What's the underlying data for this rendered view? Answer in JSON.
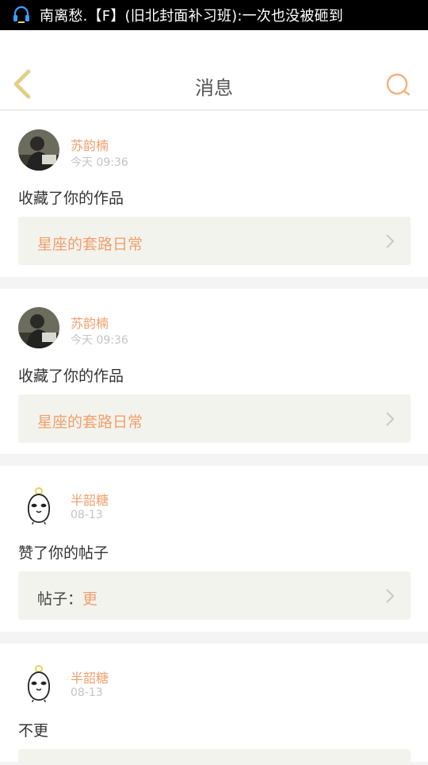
{
  "status_bar": {
    "notification_text": "南离愁.【F】(旧北封面补习班):一次也没被砸到"
  },
  "header": {
    "title": "消息"
  },
  "messages": [
    {
      "username": "苏韵楠",
      "time": "今天 09:36",
      "action": "收藏了你的作品",
      "ref_title": "星座的套路日常"
    },
    {
      "username": "苏韵楠",
      "time": "今天 09:36",
      "action": "收藏了你的作品",
      "ref_title": "星座的套路日常"
    },
    {
      "username": "半韶糖",
      "time": "08-13",
      "action": "赞了你的帖子",
      "ref_label": "帖子：",
      "ref_title": "更"
    },
    {
      "username": "半韶糖",
      "time": "08-13",
      "action": "不更"
    }
  ],
  "colors": {
    "accent": "#f0a06c",
    "back_arrow": "#e8d25a",
    "search_icon": "#f5b07a"
  }
}
